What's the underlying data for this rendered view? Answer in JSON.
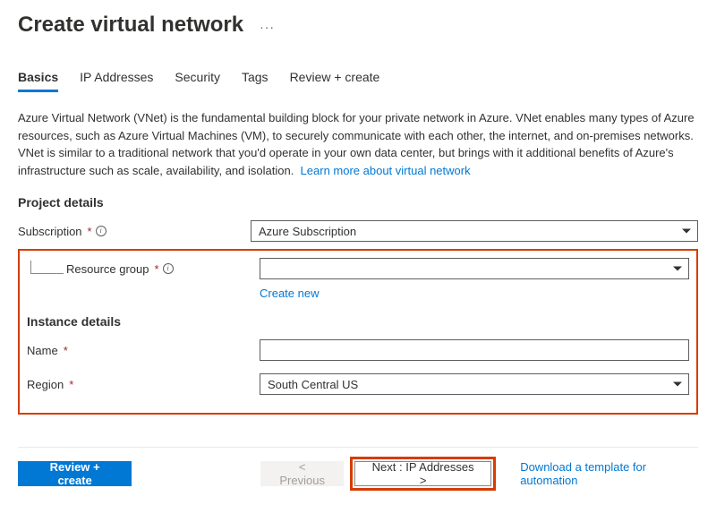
{
  "header": {
    "title": "Create virtual network"
  },
  "tabs": {
    "basics": "Basics",
    "ip": "IP Addresses",
    "security": "Security",
    "tags": "Tags",
    "review": "Review + create"
  },
  "description": {
    "text": "Azure Virtual Network (VNet) is the fundamental building block for your private network in Azure. VNet enables many types of Azure resources, such as Azure Virtual Machines (VM), to securely communicate with each other, the internet, and on-premises networks. VNet is similar to a traditional network that you'd operate in your own data center, but brings with it additional benefits of Azure's infrastructure such as scale, availability, and isolation.",
    "link_text": "Learn more about virtual network"
  },
  "sections": {
    "project_details": "Project details",
    "instance_details": "Instance details"
  },
  "fields": {
    "subscription": {
      "label": "Subscription",
      "value": "Azure Subscription"
    },
    "resource_group": {
      "label": "Resource group",
      "value": "",
      "create_new": "Create new"
    },
    "name": {
      "label": "Name",
      "value": ""
    },
    "region": {
      "label": "Region",
      "value": "South Central US"
    }
  },
  "footer": {
    "review": "Review + create",
    "previous": "< Previous",
    "next": "Next : IP Addresses >",
    "download": "Download a template for automation"
  }
}
